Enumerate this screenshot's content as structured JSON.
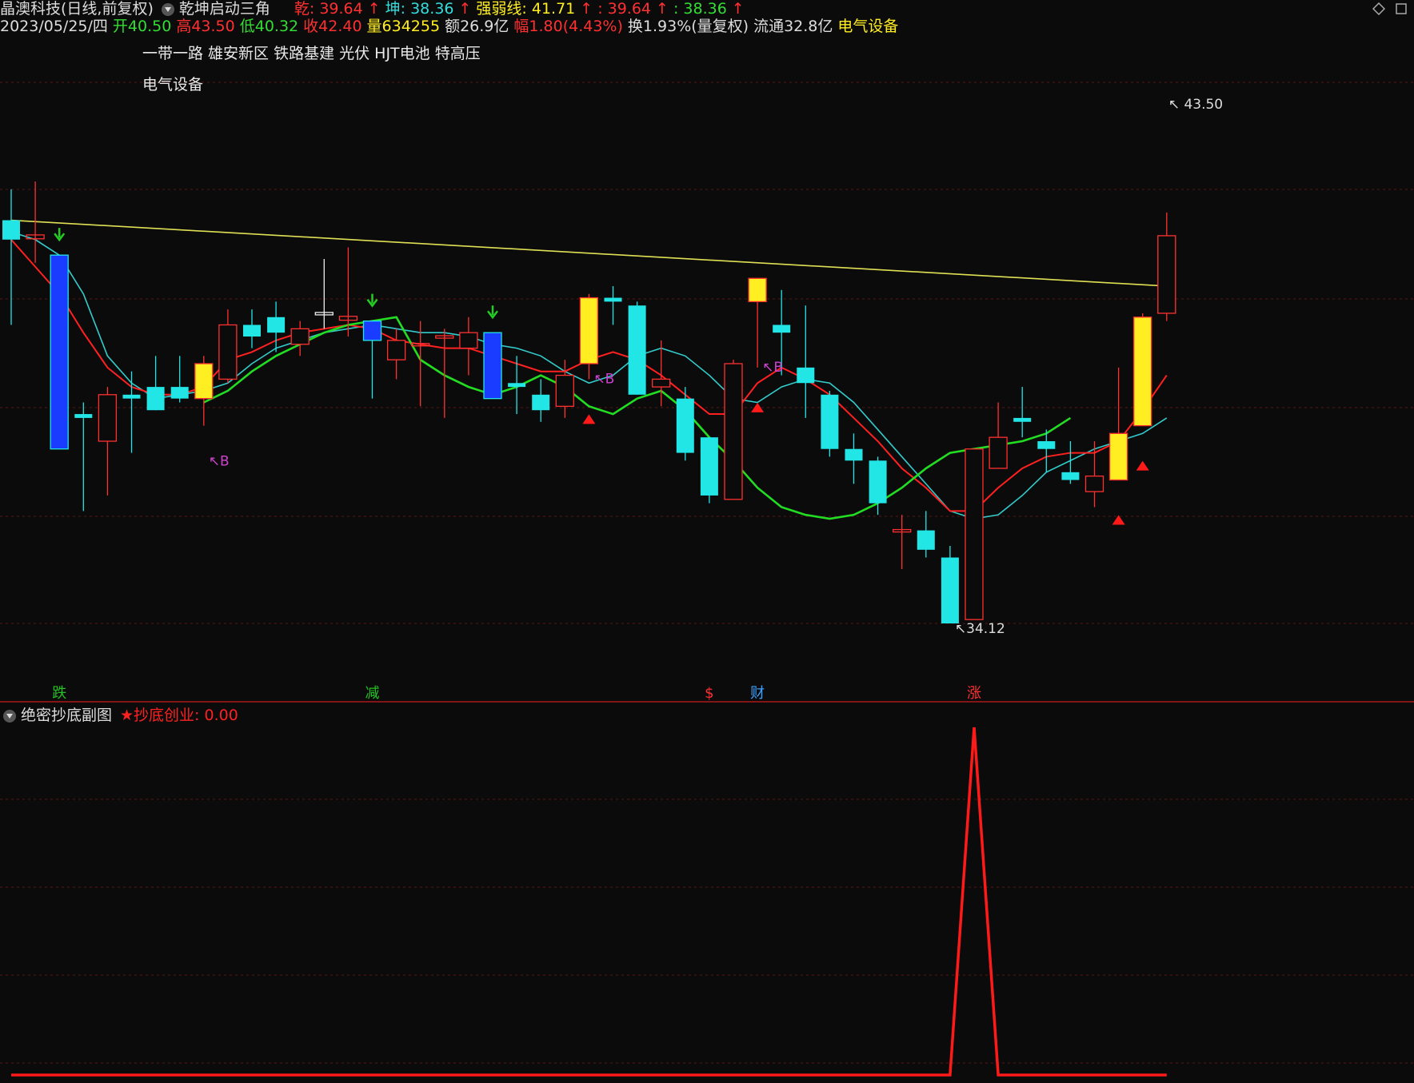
{
  "header": {
    "stock_title": "晶澳科技(日线,前复权)",
    "indicator_name": "乾坤启动三角",
    "qian_label": "乾: 39.64",
    "kun_label": "坤: 38.36",
    "strength_label": "强弱线: 41.71",
    "extra1": ": 39.64",
    "extra2": ": 38.36",
    "date": "2023/05/25/四",
    "open": "开40.50",
    "high": "高43.50",
    "low": "低40.32",
    "close": "收42.40",
    "volume": "量634255",
    "amount": "额26.9亿",
    "change": "幅1.80(4.43%)",
    "turnover": "换1.93%(量复权)",
    "float": "流通32.8亿",
    "sector": "电气设备"
  },
  "concepts": {
    "line1": "一带一路 雄安新区 铁路基建 光伏 HJT电池 特高压",
    "line2": "电气设备"
  },
  "price_labels": {
    "high": "43.50",
    "low": "34.12"
  },
  "bottom_markers": [
    {
      "text": "跌",
      "color": "#22c022"
    },
    {
      "text": "减",
      "color": "#22c022"
    },
    {
      "text": "$",
      "color": "#ff3030"
    },
    {
      "text": "财",
      "color": "#3aa0ff"
    },
    {
      "text": "涨",
      "color": "#ff3030"
    }
  ],
  "signal_label": "B",
  "sub_chart": {
    "title": "绝密抄底副图",
    "series_label": "★抄底创业: 0.00"
  },
  "colors": {
    "up": "#ff3030",
    "down": "#22e6e6",
    "blue_bar": "#1a3cff",
    "yellow_bar": "#ffee22",
    "kun_line": "#22dd22",
    "qian_line": "#ff2020",
    "slow_line": "#33cccc",
    "trend_line": "#e0e055",
    "signal": "#d040d0"
  },
  "chart_data": {
    "type": "candlestick",
    "candles": [
      {
        "o": 40.5,
        "h": 41.3,
        "l": 37.8,
        "c": 40.0,
        "col": "cyan"
      },
      {
        "o": 40.1,
        "h": 41.5,
        "l": 39.4,
        "c": 40.0,
        "col": "redcross"
      },
      {
        "o": 39.6,
        "h": 39.6,
        "l": 34.6,
        "c": 34.6,
        "col": "blue"
      },
      {
        "o": 35.5,
        "h": 35.8,
        "l": 33.0,
        "c": 35.4,
        "col": "cyan"
      },
      {
        "o": 34.8,
        "h": 36.2,
        "l": 33.4,
        "c": 36.0,
        "col": "red"
      },
      {
        "o": 36.0,
        "h": 36.6,
        "l": 34.5,
        "c": 35.9,
        "col": "cyan"
      },
      {
        "o": 36.2,
        "h": 37.0,
        "l": 35.6,
        "c": 35.6,
        "col": "cyan"
      },
      {
        "o": 36.2,
        "h": 37.0,
        "l": 35.8,
        "c": 35.9,
        "col": "cyan"
      },
      {
        "o": 35.9,
        "h": 37.0,
        "l": 35.2,
        "c": 36.8,
        "col": "yellow"
      },
      {
        "o": 36.4,
        "h": 38.2,
        "l": 36.3,
        "c": 37.8,
        "col": "red"
      },
      {
        "o": 37.8,
        "h": 38.2,
        "l": 37.2,
        "c": 37.5,
        "col": "cyan"
      },
      {
        "o": 38.0,
        "h": 38.4,
        "l": 37.1,
        "c": 37.6,
        "col": "cyan"
      },
      {
        "o": 37.3,
        "h": 37.9,
        "l": 37.0,
        "c": 37.7,
        "col": "red"
      },
      {
        "o": 38.1,
        "h": 39.5,
        "l": 37.7,
        "c": 38.1,
        "col": "whitecross"
      },
      {
        "o": 37.9,
        "h": 39.8,
        "l": 37.5,
        "c": 38.0,
        "col": "redcross"
      },
      {
        "o": 37.9,
        "h": 37.9,
        "l": 35.9,
        "c": 37.4,
        "col": "blue"
      },
      {
        "o": 36.9,
        "h": 37.7,
        "l": 36.4,
        "c": 37.4,
        "col": "red"
      },
      {
        "o": 37.3,
        "h": 37.9,
        "l": 35.7,
        "c": 37.3,
        "col": "redcross"
      },
      {
        "o": 37.5,
        "h": 37.7,
        "l": 35.4,
        "c": 37.5,
        "col": "redcross"
      },
      {
        "o": 37.2,
        "h": 38.0,
        "l": 36.5,
        "c": 37.6,
        "col": "red"
      },
      {
        "o": 37.6,
        "h": 37.6,
        "l": 35.9,
        "c": 35.9,
        "col": "blue"
      },
      {
        "o": 36.3,
        "h": 37.0,
        "l": 35.5,
        "c": 36.2,
        "col": "cyan"
      },
      {
        "o": 36.0,
        "h": 36.4,
        "l": 35.3,
        "c": 35.6,
        "col": "cyan"
      },
      {
        "o": 35.7,
        "h": 36.9,
        "l": 35.4,
        "c": 36.5,
        "col": "red"
      },
      {
        "o": 36.8,
        "h": 38.6,
        "l": 36.4,
        "c": 38.5,
        "col": "yellow"
      },
      {
        "o": 38.5,
        "h": 38.8,
        "l": 37.8,
        "c": 38.4,
        "col": "cyan"
      },
      {
        "o": 38.3,
        "h": 38.4,
        "l": 36.0,
        "c": 36.0,
        "col": "cyan"
      },
      {
        "o": 36.2,
        "h": 37.4,
        "l": 35.7,
        "c": 36.4,
        "col": "red"
      },
      {
        "o": 35.9,
        "h": 36.2,
        "l": 34.3,
        "c": 34.5,
        "col": "cyan"
      },
      {
        "o": 34.9,
        "h": 34.9,
        "l": 33.2,
        "c": 33.4,
        "col": "cyan"
      },
      {
        "o": 33.3,
        "h": 36.9,
        "l": 33.3,
        "c": 36.8,
        "col": "red"
      },
      {
        "o": 38.4,
        "h": 38.9,
        "l": 36.7,
        "c": 39.0,
        "col": "yellow"
      },
      {
        "o": 37.8,
        "h": 38.7,
        "l": 36.5,
        "c": 37.6,
        "col": "cyan"
      },
      {
        "o": 36.7,
        "h": 38.3,
        "l": 35.4,
        "c": 36.3,
        "col": "cyan"
      },
      {
        "o": 36.0,
        "h": 36.1,
        "l": 34.4,
        "c": 34.6,
        "col": "cyan"
      },
      {
        "o": 34.6,
        "h": 35.0,
        "l": 33.7,
        "c": 34.3,
        "col": "cyan"
      },
      {
        "o": 34.3,
        "h": 34.4,
        "l": 32.9,
        "c": 33.2,
        "col": "cyan"
      },
      {
        "o": 32.5,
        "h": 32.9,
        "l": 31.5,
        "c": 32.5,
        "col": "redcross"
      },
      {
        "o": 32.5,
        "h": 33.0,
        "l": 31.8,
        "c": 32.0,
        "col": "cyan"
      },
      {
        "o": 31.8,
        "h": 32.1,
        "l": 30.1,
        "c": 30.1,
        "col": "cyan"
      },
      {
        "o": 30.2,
        "h": 34.6,
        "l": 30.2,
        "c": 34.6,
        "col": "red"
      },
      {
        "o": 34.1,
        "h": 35.8,
        "l": 34.1,
        "c": 34.9,
        "col": "red"
      },
      {
        "o": 35.4,
        "h": 36.2,
        "l": 34.9,
        "c": 35.3,
        "col": "cyan"
      },
      {
        "o": 34.8,
        "h": 35.1,
        "l": 34.0,
        "c": 34.6,
        "col": "cyan"
      },
      {
        "o": 34.0,
        "h": 34.8,
        "l": 33.7,
        "c": 33.8,
        "col": "cyan"
      },
      {
        "o": 33.5,
        "h": 34.8,
        "l": 33.1,
        "c": 33.9,
        "col": "red"
      },
      {
        "o": 33.8,
        "h": 36.7,
        "l": 33.8,
        "c": 35.0,
        "col": "yellow"
      },
      {
        "o": 35.2,
        "h": 38.1,
        "l": 35.2,
        "c": 38.0,
        "col": "yellow"
      },
      {
        "o": 38.1,
        "h": 40.7,
        "l": 37.9,
        "c": 40.1,
        "col": "red"
      }
    ],
    "qian_line": [
      40.0,
      39.3,
      38.6,
      37.6,
      36.7,
      36.2,
      36.0,
      36.0,
      36.2,
      36.9,
      37.1,
      37.4,
      37.6,
      37.7,
      37.8,
      37.7,
      37.4,
      37.3,
      37.2,
      37.2,
      37.0,
      36.8,
      36.6,
      36.6,
      36.9,
      37.1,
      36.9,
      36.5,
      36.0,
      35.5,
      35.5,
      36.3,
      36.7,
      36.4,
      36.0,
      35.4,
      34.8,
      34.1,
      33.6,
      33.0,
      33.0,
      33.6,
      34.1,
      34.4,
      34.5,
      34.5,
      34.8,
      35.6,
      36.5
    ],
    "qian_start": 0,
    "kun_line": [
      35.8,
      36.1,
      36.6,
      37.0,
      37.3,
      37.6,
      37.8,
      37.9,
      38.0,
      36.9,
      36.5,
      36.2,
      36.0,
      36.2,
      36.5,
      36.2,
      35.7,
      35.5,
      35.9,
      36.1,
      35.6,
      34.9,
      34.3,
      33.6,
      33.1,
      32.9,
      32.8,
      32.9,
      33.2,
      33.6,
      34.1,
      34.5,
      34.6,
      34.7,
      34.8,
      35.0,
      35.4
    ],
    "kun_start": 8,
    "slow_line": [
      40.2,
      40.0,
      39.6,
      38.6,
      37.0,
      36.3,
      35.9,
      36.0,
      36.1,
      36.3,
      36.8,
      37.2,
      37.4,
      37.6,
      37.7,
      37.8,
      37.7,
      37.6,
      37.6,
      37.5,
      37.3,
      37.2,
      37.0,
      36.6,
      36.3,
      36.5,
      37.0,
      37.2,
      37.0,
      36.5,
      35.9,
      35.8,
      36.2,
      36.4,
      36.3,
      35.8,
      35.1,
      34.4,
      33.7,
      33.0,
      32.8,
      32.9,
      33.4,
      34.0,
      34.3,
      34.6,
      34.8,
      35.0,
      35.4
    ],
    "trend_line": [
      40.5,
      38.8
    ],
    "subchart_values": [
      0,
      0,
      0,
      0,
      0,
      0,
      0,
      0,
      0,
      0,
      0,
      0,
      0,
      0,
      0,
      0,
      0,
      0,
      0,
      0,
      0,
      0,
      0,
      0,
      0,
      0,
      0,
      0,
      0,
      0,
      0,
      0,
      0,
      0,
      0,
      0,
      0,
      0,
      0,
      0,
      0,
      0,
      0,
      0,
      0,
      0,
      0,
      0,
      0
    ],
    "subchart_peak_index": 40,
    "subchart_peak_value": 1.0
  }
}
